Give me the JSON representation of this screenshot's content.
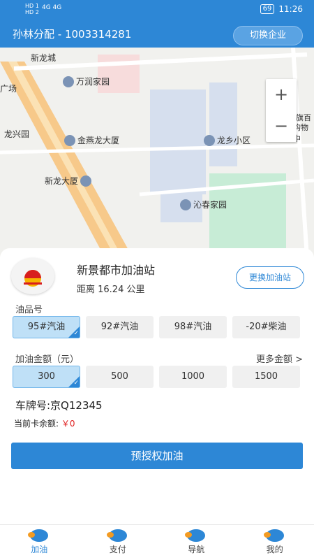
{
  "status": {
    "net1": "HD 1",
    "net2": "HD 2",
    "signal": "4G 4G",
    "battery": "69",
    "time": "11:26"
  },
  "header": {
    "title": "孙林分配 - 1003314281",
    "switch_company": "切换企业"
  },
  "map": {
    "labels": [
      "新龙城",
      "万润家园",
      "广场",
      "龙兴园",
      "金燕龙大厦",
      "龙乡小区",
      "新龙大厦",
      "沁春家园",
      "旗百",
      "购物中"
    ],
    "zoom_in": "+",
    "zoom_out": "−"
  },
  "station": {
    "name": "新景都市加油站",
    "distance": "距离 16.24 公里",
    "change": "更换加油站",
    "logo": "petrochina-logo"
  },
  "fuel": {
    "label": "油品号",
    "options": [
      "95#汽油",
      "92#汽油",
      "98#汽油",
      "-20#柴油"
    ],
    "selected": "95#汽油"
  },
  "amount": {
    "label": "加油金额（元）",
    "more": "更多金额 >",
    "options": [
      "300",
      "500",
      "1000",
      "1500"
    ],
    "selected": "300"
  },
  "plate": "车牌号:京Q12345",
  "balance": {
    "label": "当前卡余额:",
    "value": "￥0"
  },
  "primary_button": "预授权加油",
  "tabs": [
    {
      "label": "加油",
      "icon": "fuel-icon"
    },
    {
      "label": "支付",
      "icon": "pay-icon"
    },
    {
      "label": "导航",
      "icon": "navigation-icon"
    },
    {
      "label": "我的",
      "icon": "profile-icon"
    }
  ],
  "colors": {
    "accent": "#2d87d6",
    "selected_bg": "#bfe0f7",
    "balance": "#e02020"
  }
}
